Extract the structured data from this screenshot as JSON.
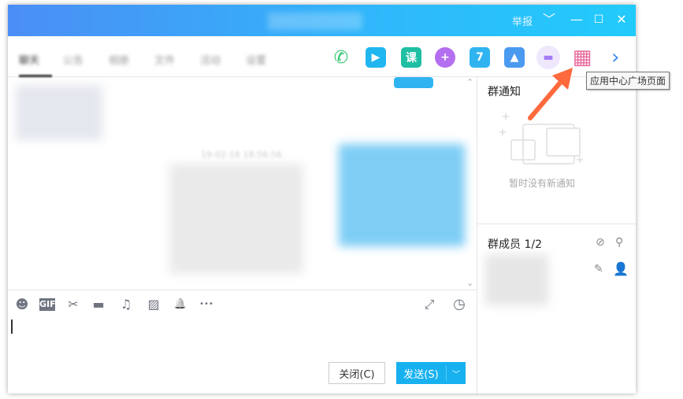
{
  "titlebar": {
    "report": "举报",
    "chevron": "﹀",
    "minimize": "—",
    "maximize": "☐",
    "close": "✕"
  },
  "tabs": [
    "聊天",
    "公告",
    "相册",
    "文件",
    "活动",
    "设置"
  ],
  "apps": [
    {
      "name": "phone-call",
      "glyph": "✆",
      "color": "#2bc46a"
    },
    {
      "name": "video-call",
      "glyph": "▶",
      "color": "#20b6f0"
    },
    {
      "name": "course",
      "glyph": "课",
      "color": "#1fbfa3"
    },
    {
      "name": "add-app",
      "glyph": "+",
      "color": "#b46ef0"
    },
    {
      "name": "calendar",
      "glyph": "7",
      "color": "#2fb4f0"
    },
    {
      "name": "photo",
      "glyph": "▲",
      "color": "#4a9af0"
    },
    {
      "name": "live",
      "glyph": "▬",
      "color": "#a57af5"
    },
    {
      "name": "app-center",
      "glyph": "▦",
      "color": "#e8679a"
    }
  ],
  "more_arrow": "›",
  "tooltip": "应用中心广场页面",
  "arrow_color": "#ff6a3d",
  "chat": {
    "timestamp": "19-02-16 18:56:56"
  },
  "notice": {
    "title": "群通知",
    "empty": "暂时没有新通知"
  },
  "members": {
    "title": "群成员 1/2"
  },
  "toolbar": {
    "emoji": "☻",
    "gif": "GIF",
    "cut": "✂",
    "folder": "▬",
    "music": "♫",
    "image": "▨",
    "bell": "🔔",
    "more": "•••",
    "expand": "⤢",
    "history": "◷"
  },
  "buttons": {
    "close": "关闭(C)",
    "send": "发送(S)",
    "send_menu": "﹀"
  }
}
